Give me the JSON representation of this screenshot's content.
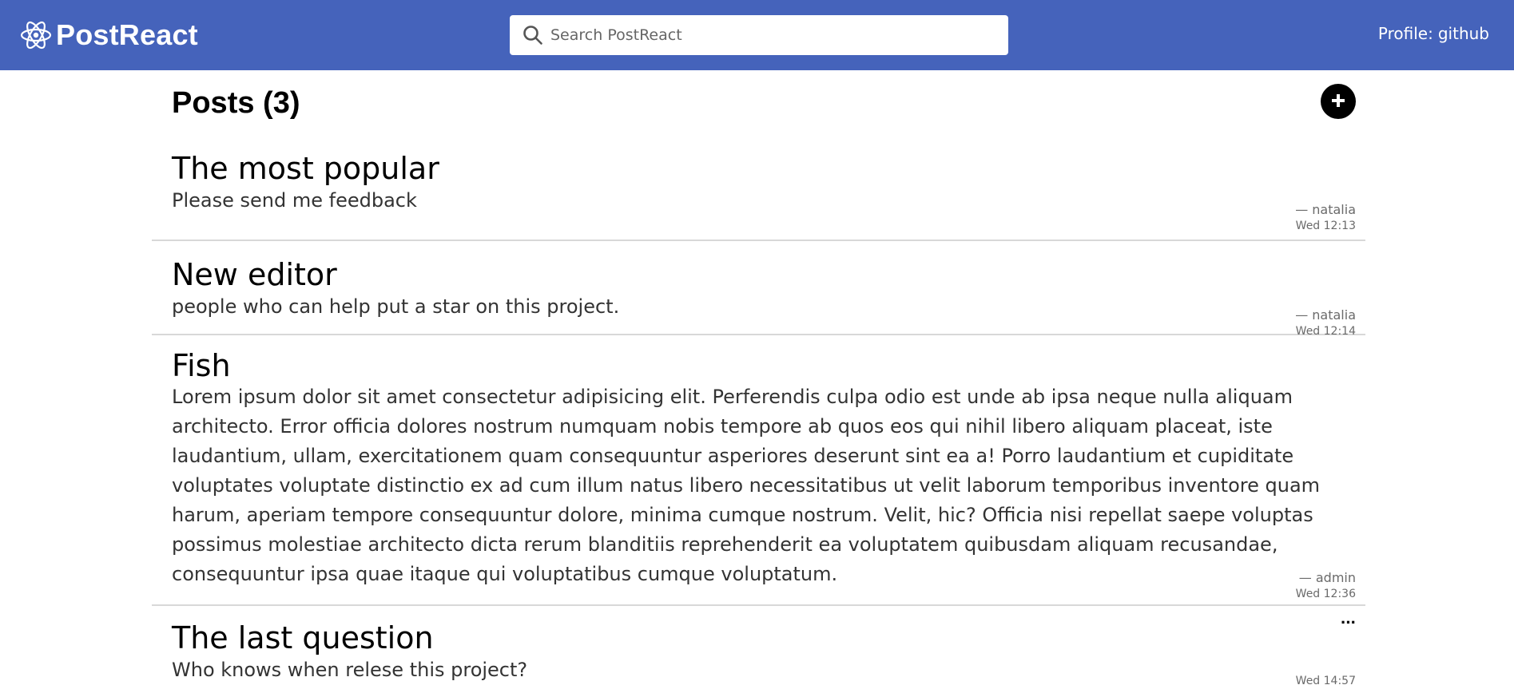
{
  "header": {
    "brand": "PostReact",
    "search_placeholder": "Search PostReact",
    "profile_label": "Profile:",
    "profile_name": "github"
  },
  "page": {
    "title": "Posts (3)"
  },
  "posts": [
    {
      "title": "The most popular",
      "body": "Please send me feedback",
      "author": "— natalia",
      "time": "Wed 12:13"
    },
    {
      "title": "New editor",
      "body": "people who can help put a star on this project.",
      "author": "— natalia",
      "time": "Wed 12:14"
    },
    {
      "title": "Fish",
      "body": "Lorem ipsum dolor sit amet consectetur adipisicing elit. Perferendis culpa odio est unde ab ipsa neque nulla aliquam architecto. Error officia dolores nostrum numquam nobis tempore ab quos eos qui nihil libero aliquam placeat, iste laudantium, ullam, exercitationem quam consequuntur asperiores deserunt sint ea a! Porro laudantium et cupiditate voluptates voluptate distinctio ex ad cum illum natus libero necessitatibus ut velit laborum temporibus inventore quam harum, aperiam tempore consequuntur dolore, minima cumque nostrum. Velit, hic? Officia nisi repellat saepe voluptas possimus molestiae architecto dicta rerum blanditiis reprehenderit ea voluptatem quibusdam aliquam recusandae, consequuntur ipsa quae itaque qui voluptatibus cumque voluptatum.",
      "author": "— admin",
      "time": "Wed 12:36"
    },
    {
      "title": "The last question",
      "body": "Who knows when relese this project?",
      "author": "",
      "time": "Wed 14:57",
      "more_label": "···"
    }
  ],
  "icons": {
    "brand": "react-atom-icon",
    "search": "search-icon",
    "add": "plus-circle-icon",
    "more": "more-horizontal-icon"
  },
  "colors": {
    "header_bg": "#4563bb",
    "text_primary": "#000000",
    "text_body": "#333333",
    "meta_text": "#6a6a6a",
    "divider": "#d8d8d8"
  }
}
